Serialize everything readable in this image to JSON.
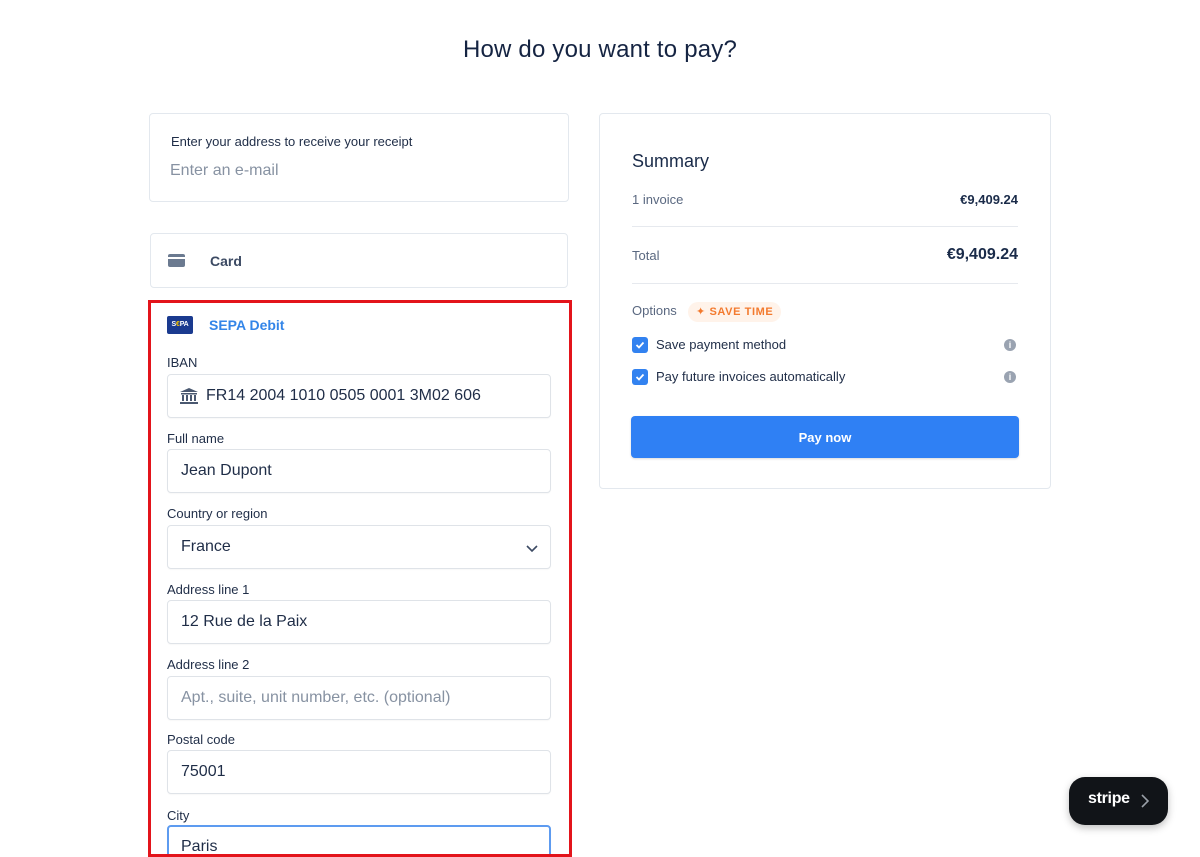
{
  "page": {
    "title": "How do you want to pay?"
  },
  "email": {
    "label": "Enter your address to receive your receipt",
    "placeholder": "Enter an e-mail"
  },
  "payment_methods": {
    "card": {
      "label": "Card",
      "icon": "credit-card-icon"
    },
    "sepa": {
      "label": "SEPA Debit",
      "logo_text": "SEPA",
      "icon": "sepa-logo-icon"
    }
  },
  "sepa_form": {
    "iban": {
      "label": "IBAN",
      "value": "FR14 2004 1010 0505 0001 3M02 606",
      "icon": "bank-icon"
    },
    "full_name": {
      "label": "Full name",
      "value": "Jean Dupont"
    },
    "country": {
      "label": "Country or region",
      "value": "France",
      "icon": "chevron-down-icon"
    },
    "address1": {
      "label": "Address line 1",
      "value": "12 Rue de la Paix"
    },
    "address2": {
      "label": "Address line 2",
      "placeholder": "Apt., suite, unit number, etc. (optional)"
    },
    "postal_code": {
      "label": "Postal code",
      "value": "75001"
    },
    "city": {
      "label": "City",
      "value": "Paris"
    }
  },
  "summary": {
    "title": "Summary",
    "invoice_label": "1 invoice",
    "invoice_amount": "€9,409.24",
    "total_label": "Total",
    "total_amount": "€9,409.24",
    "options_label": "Options",
    "badge": "SAVE TIME",
    "options": [
      {
        "label": "Save payment method",
        "checked": true
      },
      {
        "label": "Pay future invoices automatically",
        "checked": true
      }
    ],
    "pay_button": "Pay now"
  },
  "branding": {
    "stripe_label": "stripe"
  },
  "colors": {
    "accent": "#2f80f4",
    "highlight_border": "#e3141b",
    "badge_text": "#f37a2e",
    "badge_bg": "#fff3ea"
  }
}
